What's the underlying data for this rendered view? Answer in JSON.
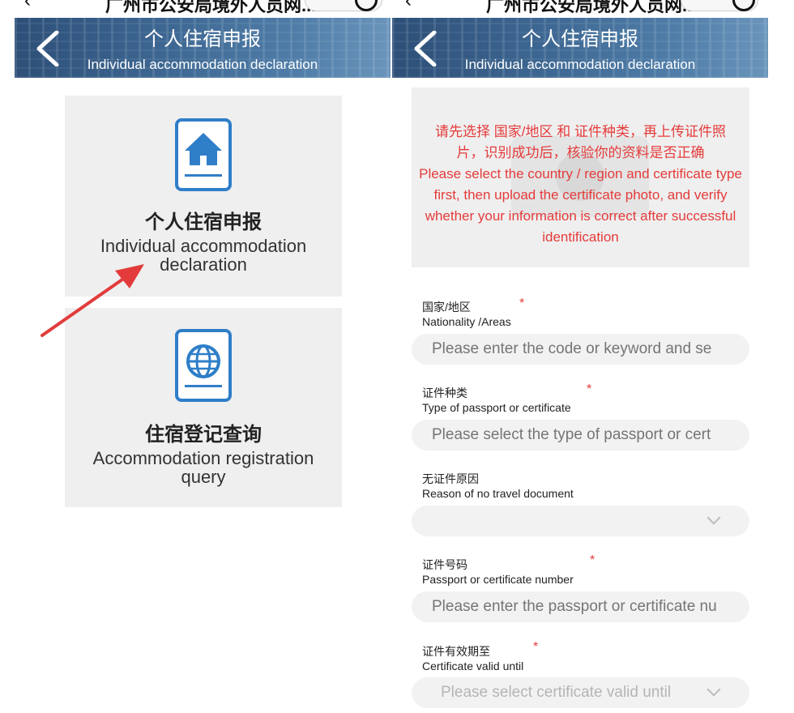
{
  "browser": {
    "left_title": "广州市公安局境外人员网...",
    "right_title": "广州市公安局境外人员网..."
  },
  "left_screen": {
    "header": {
      "title_cn": "个人住宿申报",
      "title_en": "Individual accommodation declaration"
    },
    "cards": [
      {
        "title_cn": "个人住宿申报",
        "title_en": "Individual accommodation declaration",
        "icon": "house-icon"
      },
      {
        "title_cn": "住宿登记查询",
        "title_en": "Accommodation registration query",
        "icon": "globe-icon"
      }
    ],
    "annotation": "red-arrow"
  },
  "right_screen": {
    "header": {
      "title_cn": "个人住宿申报",
      "title_en": "Individual accommodation declaration"
    },
    "notice_cn": "请先选择 国家/地区 和 证件种类，再上传证件照片，识别成功后，核验你的资料是否正确",
    "notice_en": "Please select the country / region and certificate type first, then upload the certificate photo, and verify whether your information is correct after successful identification",
    "fields": [
      {
        "label_cn": "国家/地区",
        "label_en": "Nationality /Areas",
        "required": "*",
        "placeholder": "Please enter the code or keyword and se",
        "value": ""
      },
      {
        "label_cn": "证件种类",
        "label_en": "Type of passport or certificate",
        "required": "*",
        "placeholder": "Please select the type of passport or cert",
        "value": ""
      },
      {
        "label_cn": "无证件原因",
        "label_en": "Reason of no travel document",
        "required": "",
        "placeholder": "",
        "value": ""
      },
      {
        "label_cn": "证件号码",
        "label_en": "Passport or certificate number",
        "required": "*",
        "placeholder": "Please enter the passport or certificate nu",
        "value": ""
      },
      {
        "label_cn": "证件有效期至",
        "label_en": "Certificate valid until",
        "required": "*",
        "placeholder": "Please select certificate valid until",
        "value": ""
      }
    ]
  },
  "colors": {
    "header_blue": "#3d6792",
    "icon_blue": "#2f7ec8",
    "warning_red": "#e53b3b",
    "card_gray": "#efefef"
  }
}
